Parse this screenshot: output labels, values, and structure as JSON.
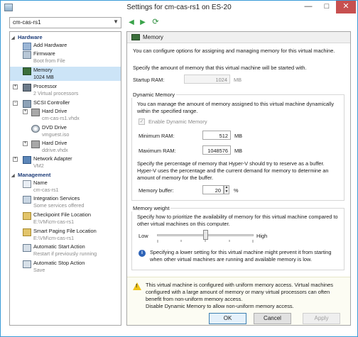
{
  "window": {
    "title": "Settings for cm-cas-rs1 on ES-20"
  },
  "vm_selector": {
    "value": "cm-cas-rs1"
  },
  "sidebar": {
    "hardware_header": "Hardware",
    "management_header": "Management",
    "hardware_items": [
      {
        "label": "Add Hardware",
        "sub": ""
      },
      {
        "label": "Firmware",
        "sub": "Boot from File"
      },
      {
        "label": "Memory",
        "sub": "1024 MB"
      },
      {
        "label": "Processor",
        "sub": "2 Virtual processors"
      },
      {
        "label": "SCSI Controller",
        "sub": ""
      },
      {
        "label": "Hard Drive",
        "sub": "cm-cas-rs1.vhdx"
      },
      {
        "label": "DVD Drive",
        "sub": "vmguest.iso"
      },
      {
        "label": "Hard Drive",
        "sub": "ddrive.vhdx"
      },
      {
        "label": "Network Adapter",
        "sub": "VM2"
      }
    ],
    "management_items": [
      {
        "label": "Name",
        "sub": "cm-cas-rs1"
      },
      {
        "label": "Integration Services",
        "sub": "Some services offered"
      },
      {
        "label": "Checkpoint File Location",
        "sub": "E:\\VM\\cm-cas-rs1"
      },
      {
        "label": "Smart Paging File Location",
        "sub": "E:\\VM\\cm-cas-rs1"
      },
      {
        "label": "Automatic Start Action",
        "sub": "Restart if previously running"
      },
      {
        "label": "Automatic Stop Action",
        "sub": "Save"
      }
    ]
  },
  "memory": {
    "header": "Memory",
    "intro": "You can configure options for assigning and managing memory for this virtual machine.",
    "startup_desc": "Specify the amount of memory that this virtual machine will be started with.",
    "startup_label": "Startup RAM:",
    "startup_value": "1024",
    "unit_mb": "MB",
    "dynamic": {
      "title": "Dynamic Memory",
      "desc": "You can manage the amount of memory assigned to this virtual machine dynamically within the specified range.",
      "enable_label": "Enable Dynamic Memory",
      "min_label": "Minimum RAM:",
      "min_value": "512",
      "max_label": "Maximum RAM:",
      "max_value": "1048576",
      "buffer_desc": "Specify the percentage of memory that Hyper-V should try to reserve as a buffer. Hyper-V uses the percentage and the current demand for memory to determine an amount of memory for the buffer.",
      "buffer_label": "Memory buffer:",
      "buffer_value": "20",
      "percent": "%"
    },
    "weight": {
      "title": "Memory weight",
      "desc": "Specify how to prioritize the availability of memory for this virtual machine compared to other virtual machines on this computer.",
      "low": "Low",
      "high": "High",
      "level": 0.5,
      "info": "Specifying a lower setting for this virtual machine might prevent it from starting when other virtual machines are running and available memory is low."
    },
    "warning": "This virtual machine is configured with uniform memory access. Virtual machines configured with a large amount of memory or many virtual processors can often benefit from non-uniform memory access.\nDisable Dynamic Memory to allow non-uniform memory access."
  },
  "buttons": {
    "ok": "OK",
    "cancel": "Cancel",
    "apply": "Apply"
  }
}
